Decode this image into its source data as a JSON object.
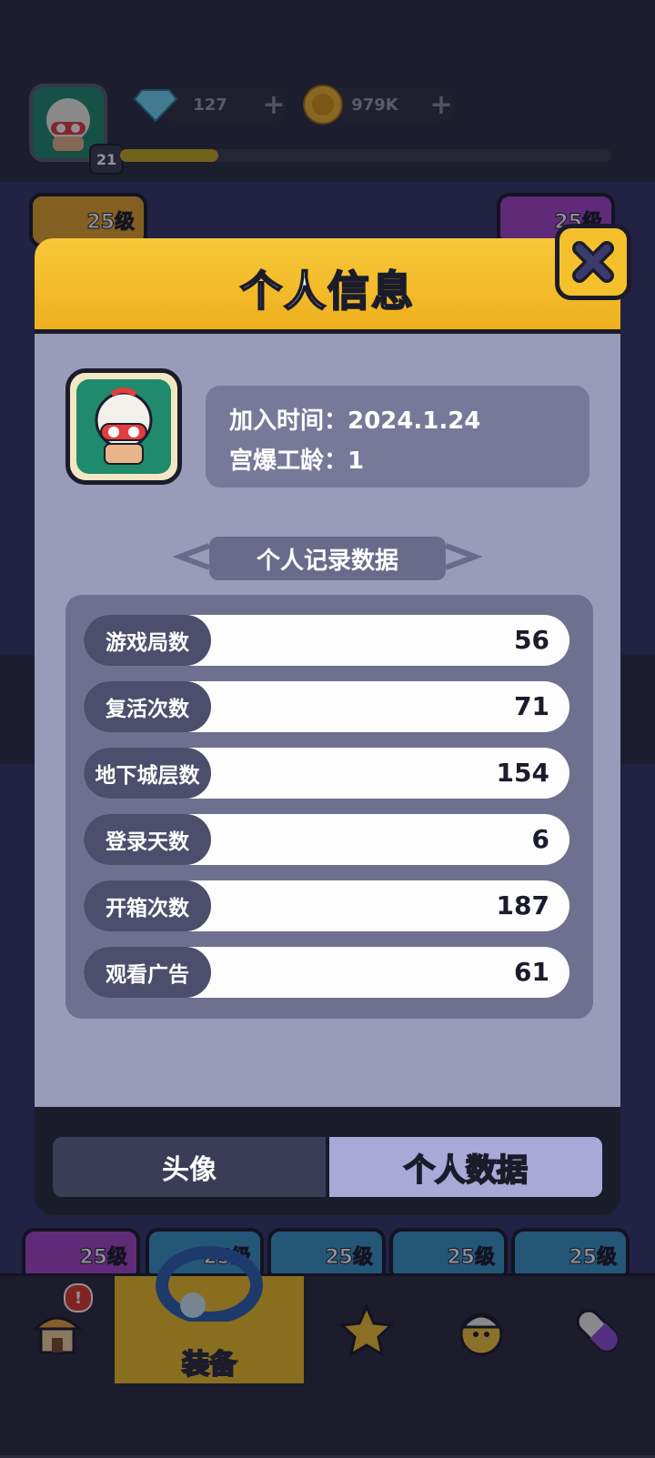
{
  "top_bar": {
    "level": "21",
    "xp_progress": 0.2,
    "gems": "127",
    "coins": "979K"
  },
  "background_cards": {
    "top_left_level": "25级",
    "top_right_level": "25级",
    "bottom_levels": [
      "25级",
      "25级",
      "25级",
      "25级",
      "25级"
    ]
  },
  "modal": {
    "title": "个人信息",
    "join_time": "加入时间：2024.1.24",
    "seniority": "宫爆工龄：1",
    "section_title": "个人记录数据",
    "stats": [
      {
        "label": "游戏局数",
        "value": "56"
      },
      {
        "label": "复活次数",
        "value": "71"
      },
      {
        "label": "地下城层数",
        "value": "154"
      },
      {
        "label": "登录天数",
        "value": "6"
      },
      {
        "label": "开箱次数",
        "value": "187"
      },
      {
        "label": "观看广告",
        "value": "61"
      }
    ],
    "tabs": {
      "avatar": "头像",
      "personal_data": "个人数据"
    }
  },
  "bottom_nav": {
    "active_label": "装备",
    "notification": "!"
  },
  "colors": {
    "header_yellow": "#f7c83a",
    "modal_body": "#9a9bb9",
    "active_tab": "#a9a8d6"
  }
}
